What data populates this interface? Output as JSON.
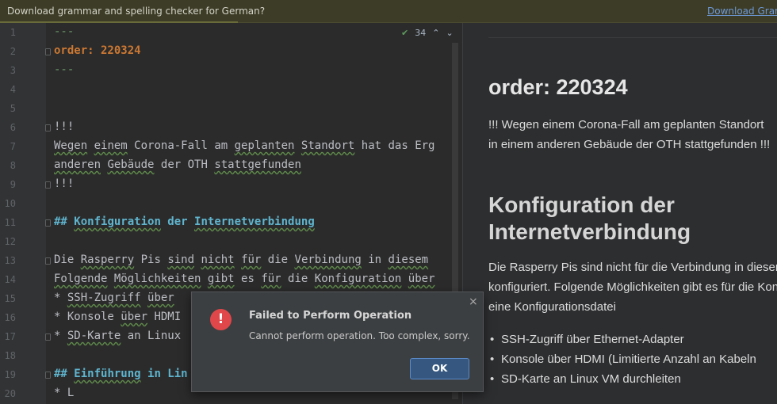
{
  "banner": {
    "message": "Download grammar and spelling checker for German?",
    "link": "Download Gramm"
  },
  "editor": {
    "inspection_count": "34",
    "line_numbers": [
      "1",
      "2",
      "3",
      "4",
      "5",
      "6",
      "7",
      "8",
      "9",
      "10",
      "11",
      "12",
      "13",
      "14",
      "15",
      "16",
      "17",
      "18",
      "19",
      "20"
    ],
    "lines": {
      "l1": "---",
      "l2_key": "order:",
      "l2_val": " 220324",
      "l3": "---",
      "l6": "!!!",
      "l7a": "Wegen",
      "l7b": "einem",
      "l7c": " Corona-Fall am ",
      "l7d": "geplanten",
      "l7e": "Standort",
      "l7f": " hat das Erg",
      "l8a": "anderen",
      "l8b": "Gebäude",
      "l8c": " der OTH ",
      "l8d": "stattgefunden",
      "l9": "!!!",
      "l11_prefix": "## ",
      "l11a": "Konfiguration",
      "l11b": " der ",
      "l11c": "Internetverbindung",
      "l13a": "Die ",
      "l13b": "Rasperry",
      "l13c": " Pis ",
      "l13d": "sind",
      "l13e": " ",
      "l13f": "nicht",
      "l13g": " ",
      "l13h": "für",
      "l13i": " die ",
      "l13j": "Verbindung",
      "l13k": " in ",
      "l13l": "diesem",
      "l14a": "Folgende",
      "l14b": " ",
      "l14c": "Möglichkeiten",
      "l14d": " ",
      "l14e": "gibt",
      "l14f": " es ",
      "l14g": "für",
      "l14h": " die ",
      "l14i": "Konfiguration",
      "l14j": " ",
      "l14k": "über",
      "l15a": "* ",
      "l15b": "SSH-Zugriff",
      "l15c": " ",
      "l15d": "über",
      "l16a": "* Konsole ",
      "l16b": "über",
      "l16c": " HDMI",
      "l17a": "* ",
      "l17b": "SD-Karte",
      "l17c": " an Linux",
      "l19_prefix": "## ",
      "l19a": "Einführung",
      "l19b": " in Lin",
      "l20": "* L"
    }
  },
  "preview": {
    "h1": "order: 220324",
    "p1_line1": "!!! Wegen einem Corona-Fall am geplanten Standort",
    "p1_line2": "in einem anderen Gebäude der OTH stattgefunden !!!",
    "h2_line1": "Konfiguration der",
    "h2_line2": "Internetverbindung",
    "p2_line1": "Die Rasperry Pis sind nicht für die Verbindung in diesem",
    "p2_line2": "konfiguriert. Folgende Möglichkeiten gibt es für die Kon",
    "p2_line3": "eine Konfigurationsdatei",
    "list": [
      "SSH-Zugriff über Ethernet-Adapter",
      "Konsole über HDMI (Limitierte Anzahl an Kabeln",
      "SD-Karte an Linux VM durchleiten"
    ]
  },
  "dialog": {
    "icon_symbol": "!",
    "title": "Failed to Perform Operation",
    "message": "Cannot perform operation. Too complex, sorry.",
    "ok_label": "OK",
    "close_symbol": "×"
  },
  "colors": {
    "banner_bg": "#3d3c26",
    "editor_bg": "#2b2b2b",
    "heading": "#5fb5cf",
    "error_icon": "#e0474a",
    "ok_button": "#365880"
  }
}
